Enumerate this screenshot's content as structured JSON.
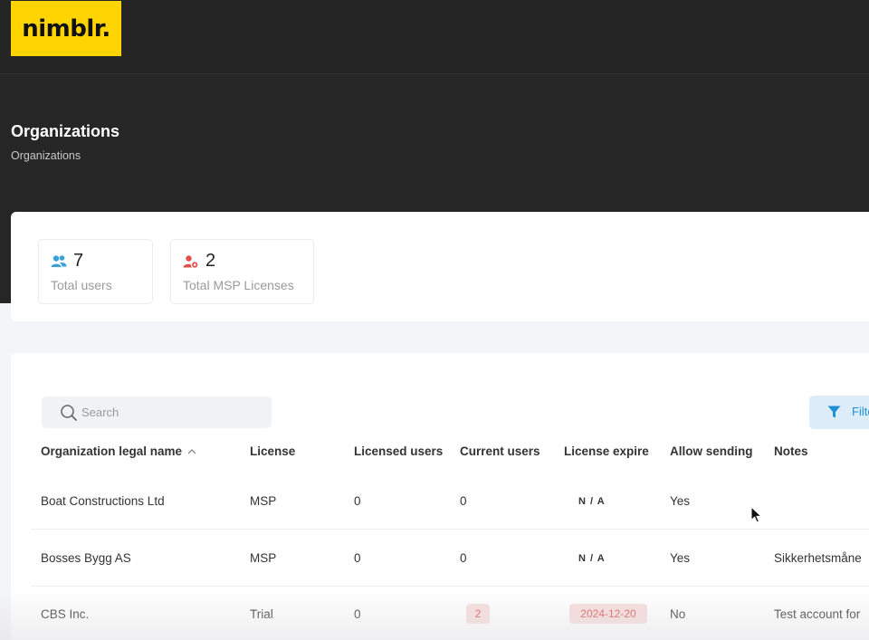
{
  "app": {
    "logo_text": "nimblr."
  },
  "page": {
    "title": "Organizations",
    "breadcrumb": "Organizations"
  },
  "stats": [
    {
      "icon": "users-icon",
      "value": "7",
      "label": "Total users",
      "color": "#3aa0dc"
    },
    {
      "icon": "user-license-icon",
      "value": "2",
      "label": "Total MSP Licenses",
      "color": "#e0504a"
    }
  ],
  "toolbar": {
    "search_placeholder": "Search",
    "filter_label": "Filte"
  },
  "table": {
    "columns": [
      "Organization legal name",
      "License",
      "Licensed users",
      "Current users",
      "License expire",
      "Allow sending",
      "Notes"
    ],
    "sorted_column": "Organization legal name",
    "rows": [
      {
        "name": "Boat Constructions Ltd",
        "license": "MSP",
        "licensed_users": "0",
        "current_users": "0",
        "license_expire": "N / A",
        "allow_sending": "Yes",
        "notes": ""
      },
      {
        "name": "Bosses Bygg AS",
        "license": "MSP",
        "licensed_users": "0",
        "current_users": "0",
        "license_expire": "N / A",
        "allow_sending": "Yes",
        "notes": "Sikkerhetsmåne"
      },
      {
        "name": "CBS Inc.",
        "license": "Trial",
        "licensed_users": "0",
        "current_users": "2",
        "license_expire": "2024-12-20",
        "allow_sending": "No",
        "notes": "Test account for"
      }
    ]
  },
  "colors": {
    "brand_yellow": "#ffd400",
    "header_dark": "#262626",
    "accent_blue": "#1e90d6",
    "warning_red": "#d9534f"
  }
}
